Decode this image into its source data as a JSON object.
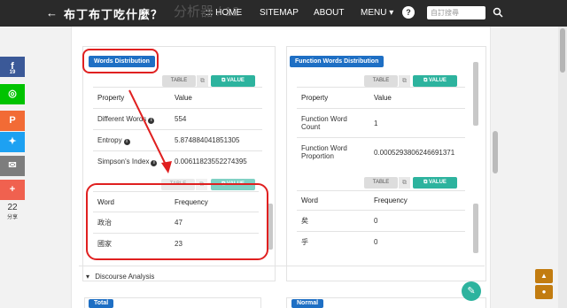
{
  "topbar": {
    "back_label": "←",
    "title": "布丁布丁吃什麼？",
    "ghost_title": "分析器 / 12",
    "nav": [
      "::: HOME",
      "SITEMAP",
      "ABOUT",
      "MENU ▾"
    ],
    "help": "?",
    "search_placeholder": "自訂搜尋"
  },
  "share": {
    "items": [
      {
        "icon": "f",
        "count": "19",
        "color": "#3b5998"
      },
      {
        "icon": "◎",
        "count": "",
        "color": "#00c300"
      },
      {
        "icon": "P",
        "count": "",
        "color": "#f26b35"
      },
      {
        "icon": "✦",
        "count": "",
        "color": "#1da1f2"
      },
      {
        "icon": "✉",
        "count": "",
        "color": "#7d7d7d"
      },
      {
        "icon": "+",
        "count": "",
        "color": "#f0614f"
      }
    ],
    "total": "22",
    "total_label": "分享"
  },
  "words": {
    "title": "Words Distribution",
    "table_btn": "TABLE",
    "value_btn": "VALUE",
    "prop_header": [
      "Property",
      "Value"
    ],
    "props": [
      {
        "name": "Different Words",
        "value": "554"
      },
      {
        "name": "Entropy",
        "value": "5.874884041851305"
      },
      {
        "name": "Simpson's Index",
        "value": "0.00611823552274395"
      }
    ],
    "freq_header": [
      "Word",
      "Frequency"
    ],
    "freq": [
      {
        "word": "政治",
        "freq": "47"
      },
      {
        "word": "國家",
        "freq": "23"
      }
    ]
  },
  "function_words": {
    "title": "Function Words Distribution",
    "table_btn": "TABLE",
    "value_btn": "VALUE",
    "prop_header": [
      "Property",
      "Value"
    ],
    "props": [
      {
        "name": "Function Word Count",
        "value": "1"
      },
      {
        "name": "Function Word Proportion",
        "value": "0.0005293806246691371"
      }
    ],
    "freq_header": [
      "Word",
      "Frequency"
    ],
    "freq": [
      {
        "word": "矣",
        "freq": "0"
      },
      {
        "word": "乎",
        "freq": "0"
      }
    ]
  },
  "discourse": {
    "title": "Discourse Analysis",
    "toggle": "▾",
    "btn_total": "Total",
    "btn_normal": "Normal"
  },
  "fab_icon": "✎",
  "side_buttons": [
    "▲",
    "●"
  ]
}
